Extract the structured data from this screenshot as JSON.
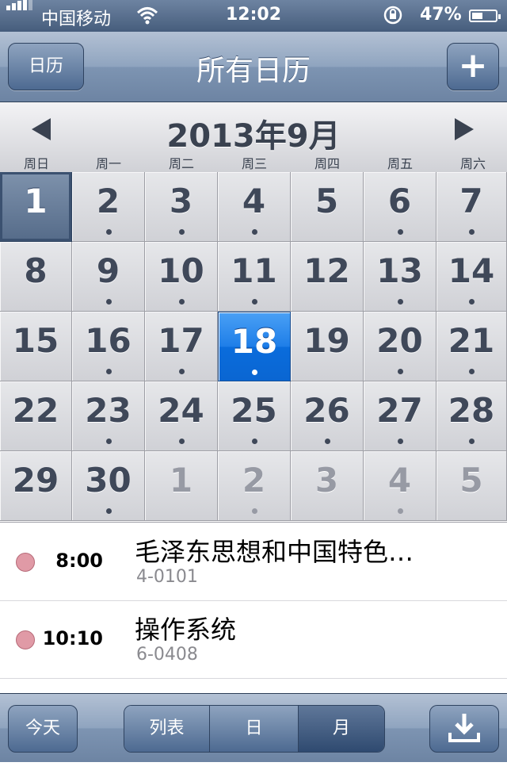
{
  "status_bar": {
    "carrier": "中国移动",
    "time": "12:02",
    "battery_percent": "47%",
    "battery_level": 0.47,
    "icons": [
      "signal-icon",
      "wifi-icon",
      "rotation-lock-icon",
      "battery-icon"
    ]
  },
  "nav": {
    "left_button": "日历",
    "title": "所有日历",
    "right_button": "+"
  },
  "calendar": {
    "month_title": "2013年9月",
    "weekdays": [
      "周日",
      "周一",
      "周二",
      "周三",
      "周四",
      "周五",
      "周六"
    ],
    "weeks": [
      [
        {
          "day": "1",
          "state": "today",
          "dot": false
        },
        {
          "day": "2",
          "dot": true
        },
        {
          "day": "3",
          "dot": true
        },
        {
          "day": "4",
          "dot": true
        },
        {
          "day": "5",
          "dot": false
        },
        {
          "day": "6",
          "dot": true
        },
        {
          "day": "7",
          "dot": true
        }
      ],
      [
        {
          "day": "8",
          "dot": false
        },
        {
          "day": "9",
          "dot": true
        },
        {
          "day": "10",
          "dot": true
        },
        {
          "day": "11",
          "dot": true
        },
        {
          "day": "12",
          "dot": false
        },
        {
          "day": "13",
          "dot": true
        },
        {
          "day": "14",
          "dot": true
        }
      ],
      [
        {
          "day": "15",
          "dot": false
        },
        {
          "day": "16",
          "dot": true
        },
        {
          "day": "17",
          "dot": true
        },
        {
          "day": "18",
          "state": "selected",
          "dot": true
        },
        {
          "day": "19",
          "dot": false
        },
        {
          "day": "20",
          "dot": true
        },
        {
          "day": "21",
          "dot": true
        }
      ],
      [
        {
          "day": "22",
          "dot": false
        },
        {
          "day": "23",
          "dot": true
        },
        {
          "day": "24",
          "dot": true
        },
        {
          "day": "25",
          "dot": true
        },
        {
          "day": "26",
          "dot": true
        },
        {
          "day": "27",
          "dot": true
        },
        {
          "day": "28",
          "dot": true
        }
      ],
      [
        {
          "day": "29",
          "dot": false
        },
        {
          "day": "30",
          "dot": true
        },
        {
          "day": "1",
          "state": "other",
          "dot": false
        },
        {
          "day": "2",
          "state": "other",
          "dot": true
        },
        {
          "day": "3",
          "state": "other",
          "dot": false
        },
        {
          "day": "4",
          "state": "other",
          "dot": true
        },
        {
          "day": "5",
          "state": "other",
          "dot": false
        }
      ]
    ]
  },
  "events": [
    {
      "time": "8:00",
      "title": "毛泽东思想和中国特色…",
      "location": "4-0101",
      "color": "#e09aa6"
    },
    {
      "time": "10:10",
      "title": "操作系统",
      "location": "6-0408",
      "color": "#e09aa6"
    }
  ],
  "toolbar": {
    "today": "今天",
    "segments": [
      "列表",
      "日",
      "月"
    ],
    "active_segment": "月"
  }
}
